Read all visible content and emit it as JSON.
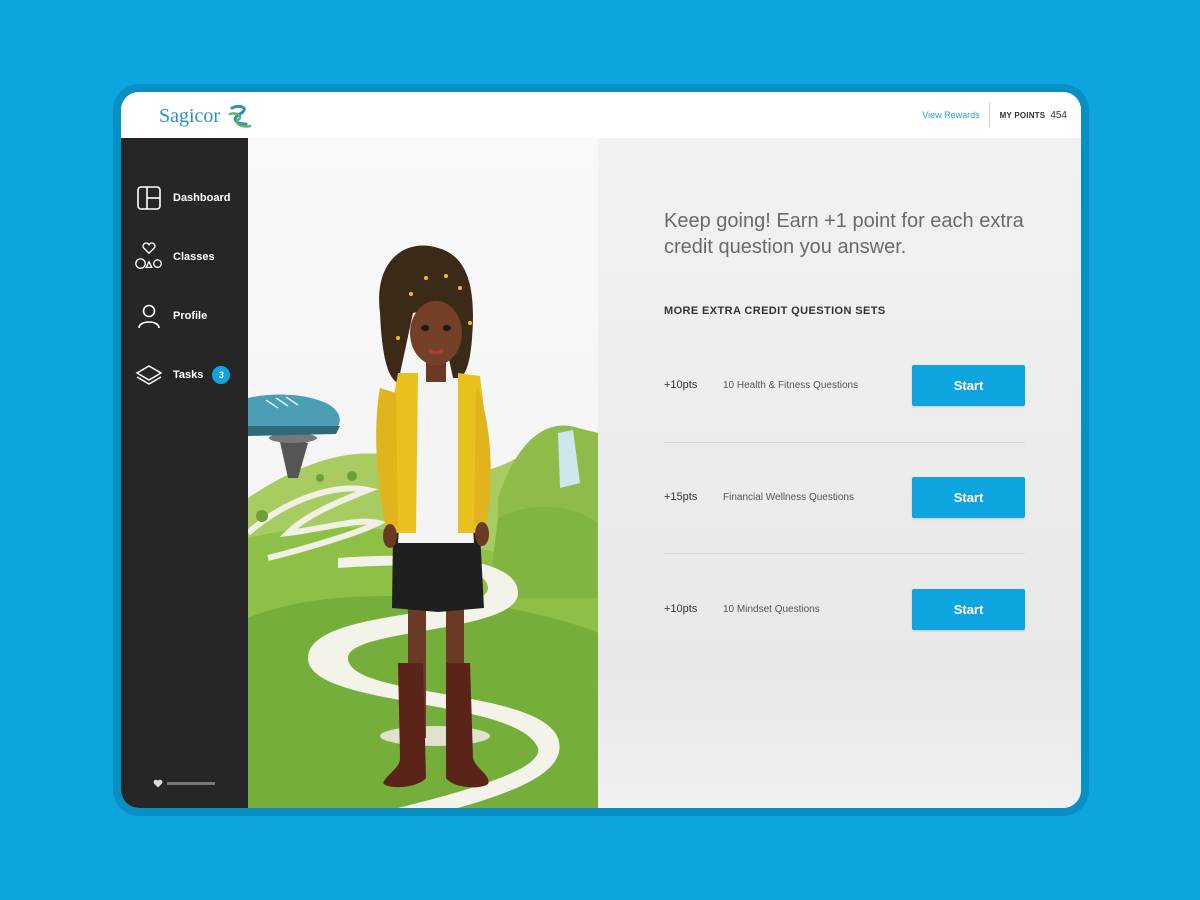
{
  "brand": {
    "name": "Sagicor",
    "colors": {
      "accent": "#0ea5df",
      "logo": "#2a8fc4",
      "sidebar": "#262626",
      "logo_green": "#5bb85c"
    }
  },
  "header": {
    "view_rewards": "View Rewards",
    "points_label": "MY POINTS",
    "points_value": "454"
  },
  "sidebar": {
    "items": [
      {
        "label": "Dashboard",
        "icon": "dashboard-icon"
      },
      {
        "label": "Classes",
        "icon": "classes-icon"
      },
      {
        "label": "Profile",
        "icon": "profile-icon"
      },
      {
        "label": "Tasks",
        "icon": "layers-icon",
        "badge": "3"
      }
    ],
    "powered_icon": "heart-icon"
  },
  "main": {
    "headline": "Keep going! Earn +1 point for each extra credit question you answer.",
    "section_title": "MORE EXTRA CREDIT QUESTION SETS",
    "question_sets": [
      {
        "points": "+10pts",
        "name": "10 Health & Fitness Questions",
        "button": "Start"
      },
      {
        "points": "+15pts",
        "name": "Financial Wellness Questions",
        "button": "Start"
      },
      {
        "points": "+10pts",
        "name": "10 Mindset Questions",
        "button": "Start"
      }
    ]
  }
}
